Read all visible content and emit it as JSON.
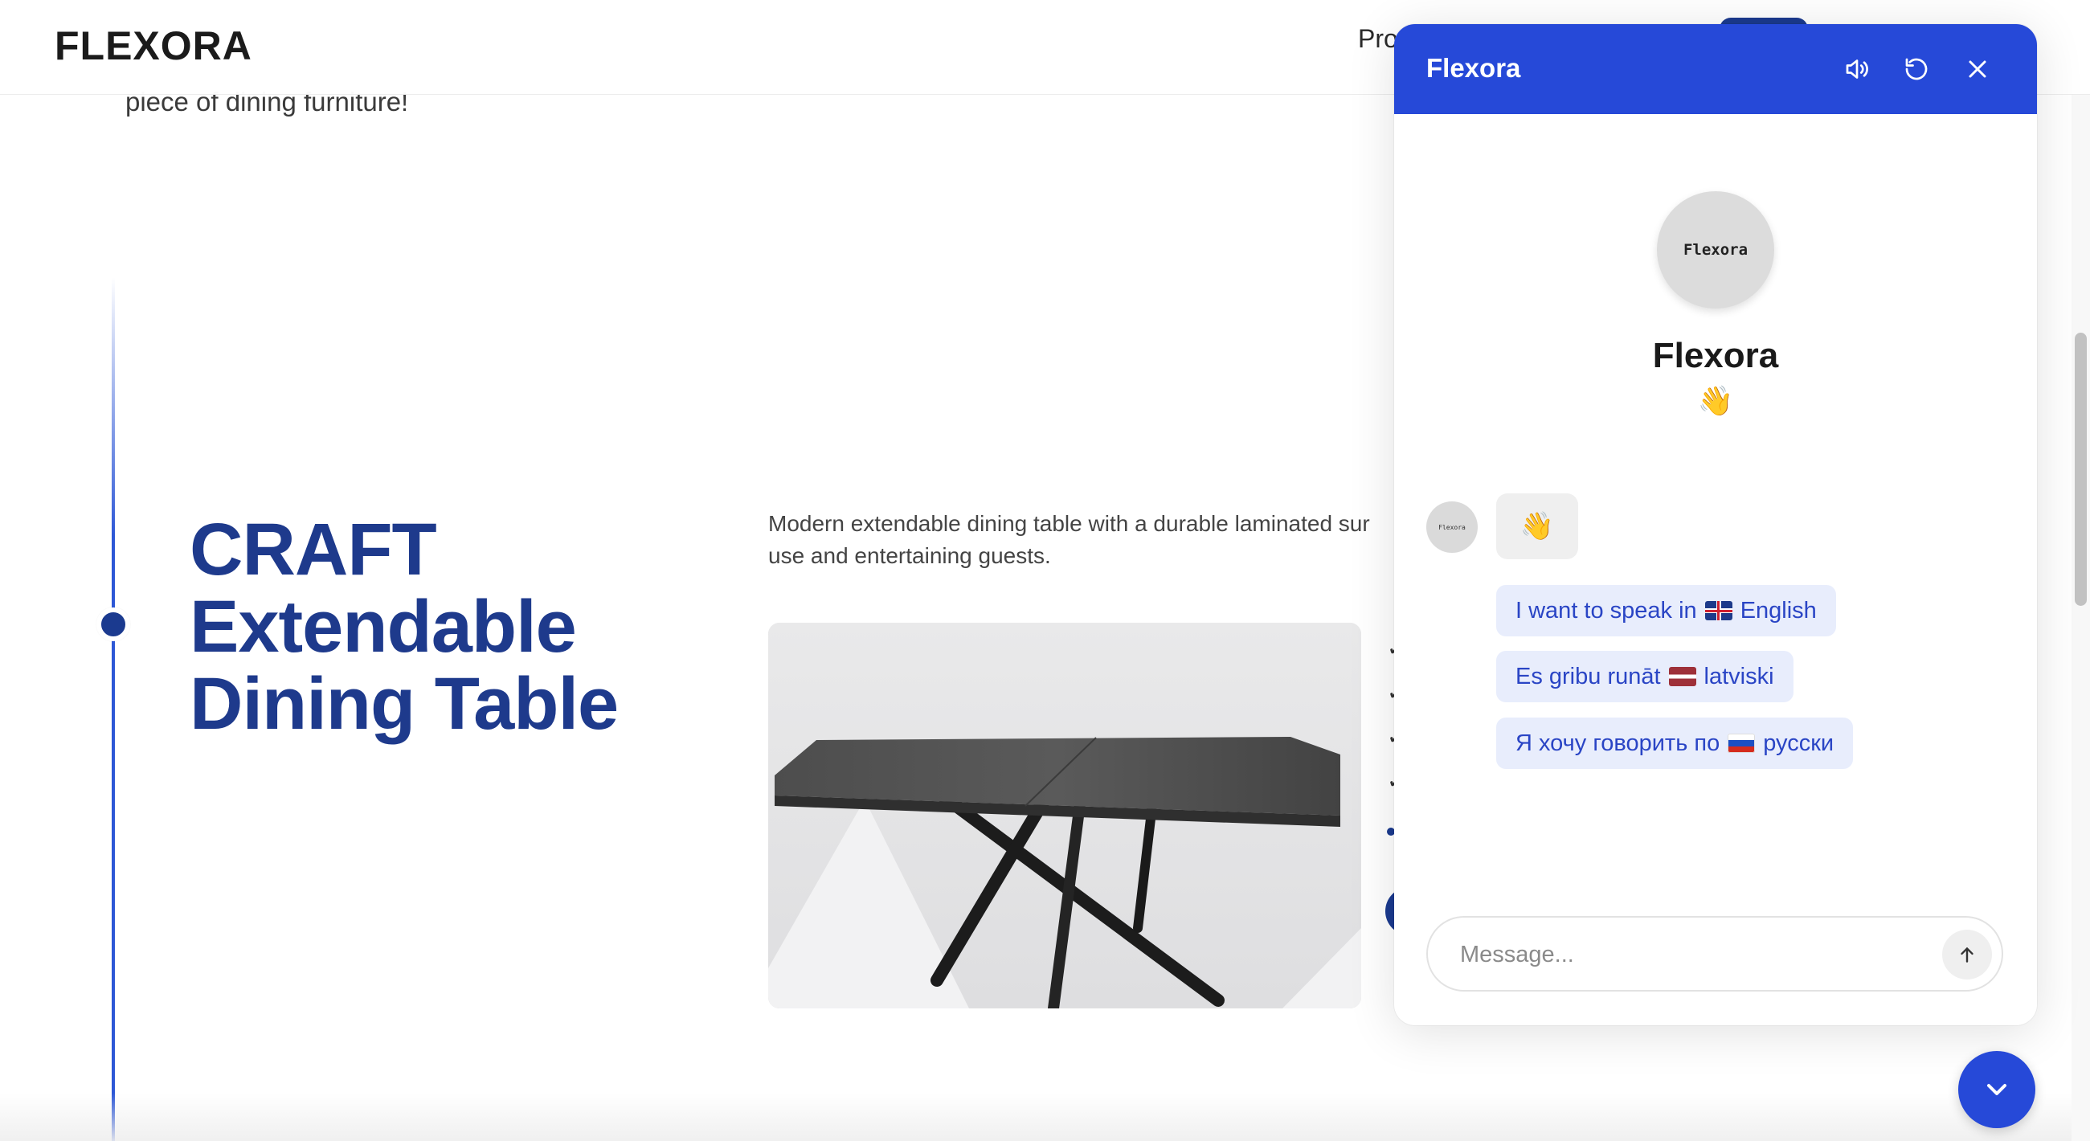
{
  "header": {
    "logo": "FLEXORA",
    "nav_item_partial": "Pro"
  },
  "intro": {
    "tail_line": "piece of dining furniture!"
  },
  "product": {
    "title_lines": [
      "CRAFT",
      "Extendable",
      "Dining Table"
    ],
    "description_lines": [
      "Modern extendable dining table with a durable laminated sur",
      "use and entertaining guests."
    ],
    "image_alt": "Dark grey laminated dining table with black cross legs"
  },
  "chat": {
    "title": "Flexora",
    "header_icons": [
      "speaker-icon",
      "refresh-icon",
      "close-icon"
    ],
    "avatar_text": "Flexora",
    "bot_name": "Flexora",
    "greeting_emoji": "👋",
    "message_emoji": "👋",
    "quick_replies": [
      {
        "prefix": "I want to speak in",
        "flag": "uk",
        "suffix": "English"
      },
      {
        "prefix": "Es gribu runāt",
        "flag": "lv",
        "suffix": "latviski"
      },
      {
        "prefix": "Я хочу говорить по",
        "flag": "ru",
        "suffix": "русски"
      }
    ],
    "composer": {
      "placeholder": "Message..."
    }
  },
  "colors": {
    "brand_blue": "#2649d8",
    "title_navy": "#1e3a8c",
    "quick_reply_bg": "#e8edfc"
  }
}
